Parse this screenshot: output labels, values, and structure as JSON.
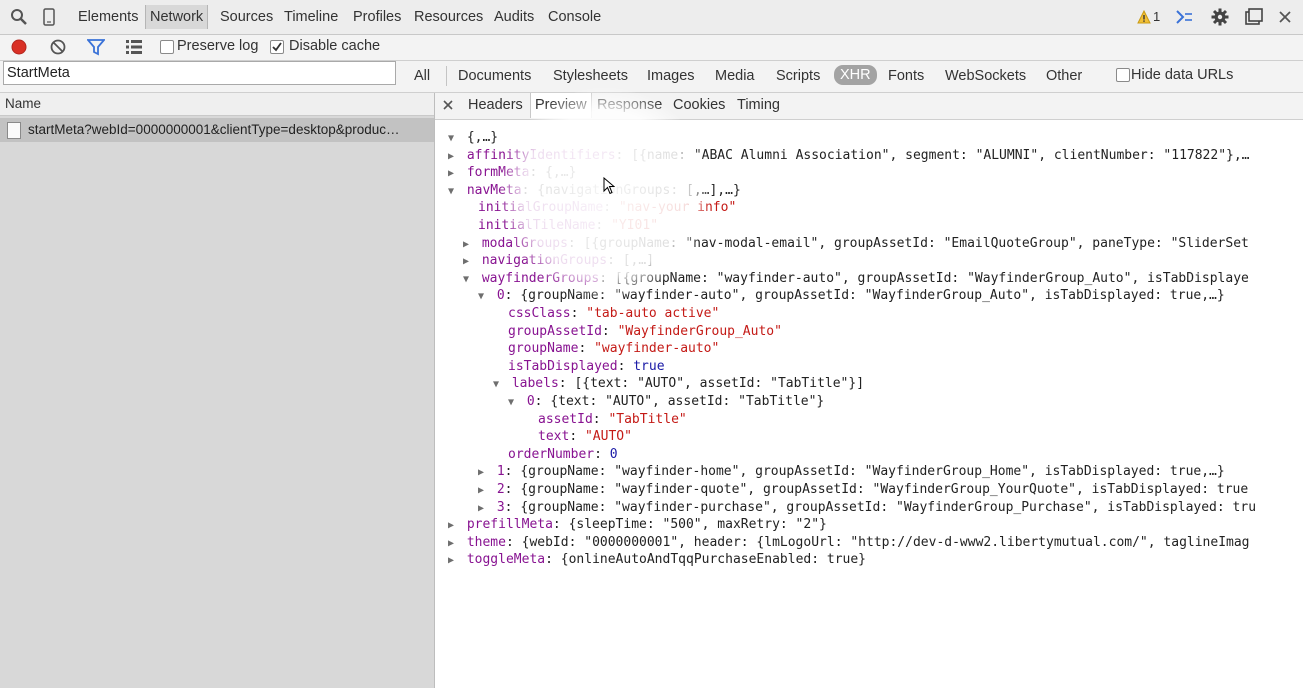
{
  "toolbar": {
    "tabs": [
      "Elements",
      "Network",
      "Sources",
      "Timeline",
      "Profiles",
      "Resources",
      "Audits",
      "Console"
    ],
    "warning_count": "1"
  },
  "network_toolbar": {
    "preserve_log": "Preserve log",
    "disable_cache": "Disable cache"
  },
  "filter": {
    "value": "StartMeta",
    "types": [
      "All",
      "Documents",
      "Stylesheets",
      "Images",
      "Media",
      "Scripts",
      "XHR",
      "Fonts",
      "WebSockets",
      "Other"
    ],
    "selected_type": "XHR",
    "hide_data_urls": "Hide data URLs"
  },
  "requests": {
    "column_name": "Name",
    "items": [
      "startMeta?webId=0000000001&clientType=desktop&produc…"
    ]
  },
  "detail": {
    "tabs": [
      "Headers",
      "Preview",
      "Response",
      "Cookies",
      "Timing"
    ],
    "selected_tab": "Preview"
  },
  "preview": [
    {
      "tri": "▼",
      "k": "",
      "sep": "",
      "v": "{,…}",
      "vt": "plain"
    },
    {
      "tri": "▶",
      "k": "affinityIdentifiers",
      "sep": ": ",
      "v": "[{name: \"ABAC Alumni Association\", segment: \"ALUMNI\", clientNumber: \"117822\"},…",
      "vt": "plain"
    },
    {
      "tri": "▶",
      "k": "formMeta",
      "sep": ": ",
      "v": "{,…}",
      "vt": "plain"
    },
    {
      "tri": "▼",
      "k": "navMeta",
      "sep": ": ",
      "v": "{navigationGroups: [,…],…}",
      "vt": "plain"
    },
    {
      "tri": "",
      "k": "initialGroupName",
      "sep": ": ",
      "v": "\"nav-your info\"",
      "vt": "s"
    },
    {
      "tri": "",
      "k": "initialTileName",
      "sep": ": ",
      "v": "\"YI01\"",
      "vt": "s"
    },
    {
      "tri": "▶",
      "k": "modalGroups",
      "sep": ": ",
      "v": "[{groupName: \"nav-modal-email\", groupAssetId: \"EmailQuoteGroup\", paneType: \"SliderSet",
      "vt": "plain"
    },
    {
      "tri": "▶",
      "k": "navigationGroups",
      "sep": ": ",
      "v": "[,…]",
      "vt": "plain"
    },
    {
      "tri": "▼",
      "k": "wayfinderGroups",
      "sep": ": ",
      "v": "[{groupName: \"wayfinder-auto\", groupAssetId: \"WayfinderGroup_Auto\", isTabDisplaye",
      "vt": "plain"
    },
    {
      "tri": "▼",
      "k": "0",
      "sep": ": ",
      "v": "{groupName: \"wayfinder-auto\", groupAssetId: \"WayfinderGroup_Auto\", isTabDisplayed: true,…}",
      "vt": "plain"
    },
    {
      "tri": "",
      "k": "cssClass",
      "sep": ": ",
      "v": "\"tab-auto active\"",
      "vt": "s"
    },
    {
      "tri": "",
      "k": "groupAssetId",
      "sep": ": ",
      "v": "\"WayfinderGroup_Auto\"",
      "vt": "s"
    },
    {
      "tri": "",
      "k": "groupName",
      "sep": ": ",
      "v": "\"wayfinder-auto\"",
      "vt": "s"
    },
    {
      "tri": "",
      "k": "isTabDisplayed",
      "sep": ": ",
      "v": "true",
      "vt": "n"
    },
    {
      "tri": "▼",
      "k": "labels",
      "sep": ": ",
      "v": "[{text: \"AUTO\", assetId: \"TabTitle\"}]",
      "vt": "plain"
    },
    {
      "tri": "▼",
      "k": "0",
      "sep": ": ",
      "v": "{text: \"AUTO\", assetId: \"TabTitle\"}",
      "vt": "plain"
    },
    {
      "tri": "",
      "k": "assetId",
      "sep": ": ",
      "v": "\"TabTitle\"",
      "vt": "s"
    },
    {
      "tri": "",
      "k": "text",
      "sep": ": ",
      "v": "\"AUTO\"",
      "vt": "s"
    },
    {
      "tri": "",
      "k": "orderNumber",
      "sep": ": ",
      "v": "0",
      "vt": "n"
    },
    {
      "tri": "▶",
      "k": "1",
      "sep": ": ",
      "v": "{groupName: \"wayfinder-home\", groupAssetId: \"WayfinderGroup_Home\", isTabDisplayed: true,…}",
      "vt": "plain"
    },
    {
      "tri": "▶",
      "k": "2",
      "sep": ": ",
      "v": "{groupName: \"wayfinder-quote\", groupAssetId: \"WayfinderGroup_YourQuote\", isTabDisplayed: true",
      "vt": "plain"
    },
    {
      "tri": "▶",
      "k": "3",
      "sep": ": ",
      "v": "{groupName: \"wayfinder-purchase\", groupAssetId: \"WayfinderGroup_Purchase\", isTabDisplayed: tru",
      "vt": "plain"
    },
    {
      "tri": "▶",
      "k": "prefillMeta",
      "sep": ": ",
      "v": "{sleepTime: \"500\", maxRetry: \"2\"}",
      "vt": "plain"
    },
    {
      "tri": "▶",
      "k": "theme",
      "sep": ": ",
      "v": "{webId: \"0000000001\", header: {lmLogoUrl: \"http://dev-d-www2.libertymutual.com/\", taglineImag",
      "vt": "plain"
    },
    {
      "tri": "▶",
      "k": "toggleMeta",
      "sep": ": ",
      "v": "{onlineAutoAndTqqPurchaseEnabled: true}",
      "vt": "plain"
    }
  ]
}
